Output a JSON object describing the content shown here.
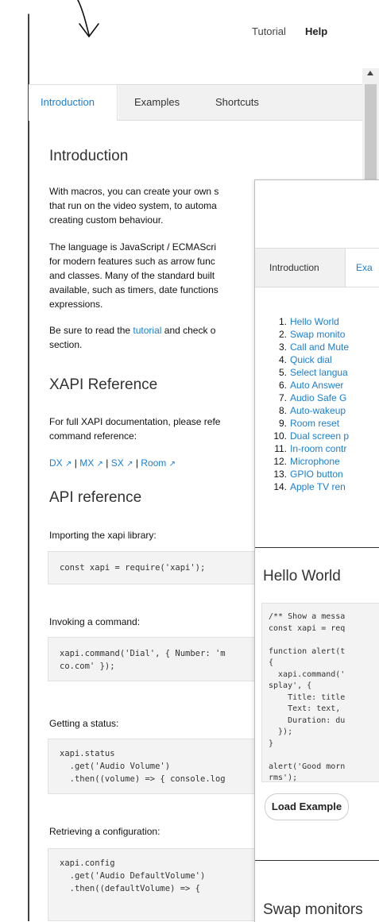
{
  "topnav": {
    "tutorial": "Tutorial",
    "help": "Help"
  },
  "tabs": [
    "Introduction",
    "Examples",
    "Shortcuts"
  ],
  "intro": {
    "heading": "Introduction",
    "p1": [
      "With macros, you can create your own s",
      "that run on the video system, to automa",
      "creating custom behaviour."
    ],
    "p2": [
      "The language is JavaScript / ECMAScri",
      "for modern features such as arrow func",
      "and classes. Many of the standard built",
      "available, such as timers, date functions",
      "expressions."
    ],
    "p3_pre": "Be sure to read the ",
    "p3_link": "tutorial",
    "p3_post": " and check o",
    "p3_line2": "section."
  },
  "xapi_ref": {
    "heading": "XAPI Reference",
    "text": [
      "For full XAPI documentation, please refe",
      "command reference:"
    ],
    "links": [
      "DX",
      "MX",
      "SX",
      "Room"
    ]
  },
  "api_ref": {
    "heading": "API reference",
    "import_label": "Importing the xapi library:",
    "import_code": "const xapi = require('xapi');",
    "invoke_label": "Invoking a command:",
    "invoke_code": "xapi.command('Dial', { Number: 'm\nco.com' });",
    "status_label": "Getting a status:",
    "status_code": "xapi.status\n  .get('Audio Volume')\n  .then((volume) => { console.log",
    "config_label": "Retrieving a configuration:",
    "config_code": "xapi.config\n  .get('Audio DefaultVolume')\n  .then((defaultVolume) => {"
  },
  "front": {
    "tabs": [
      "Introduction",
      "Exa"
    ],
    "examples": [
      {
        "n": "1.",
        "t": "Hello World"
      },
      {
        "n": "2.",
        "t": "Swap monito"
      },
      {
        "n": "3.",
        "t": "Call and Mute"
      },
      {
        "n": "4.",
        "t": "Quick dial"
      },
      {
        "n": "5.",
        "t": "Select langua"
      },
      {
        "n": "6.",
        "t": "Auto Answer"
      },
      {
        "n": "7.",
        "t": "Audio Safe G"
      },
      {
        "n": "8.",
        "t": "Auto-wakeup"
      },
      {
        "n": "9.",
        "t": "Room reset"
      },
      {
        "n": "10.",
        "t": "Dual screen p"
      },
      {
        "n": "11.",
        "t": "In-room contr"
      },
      {
        "n": "12.",
        "t": "Microphone"
      },
      {
        "n": "13.",
        "t": "GPIO button"
      },
      {
        "n": "14.",
        "t": "Apple TV ren"
      }
    ],
    "hello_heading": "Hello World",
    "hello_code": "/** Show a messa\nconst xapi = req\n\nfunction alert(t\n{\n  xapi.command('\nsplay', {\n    Title: title\n    Text: text,\n    Duration: du\n  });\n}\n\nalert('Good morn\nrms');",
    "load_button": "Load Example",
    "swap_heading": "Swap monitors"
  }
}
